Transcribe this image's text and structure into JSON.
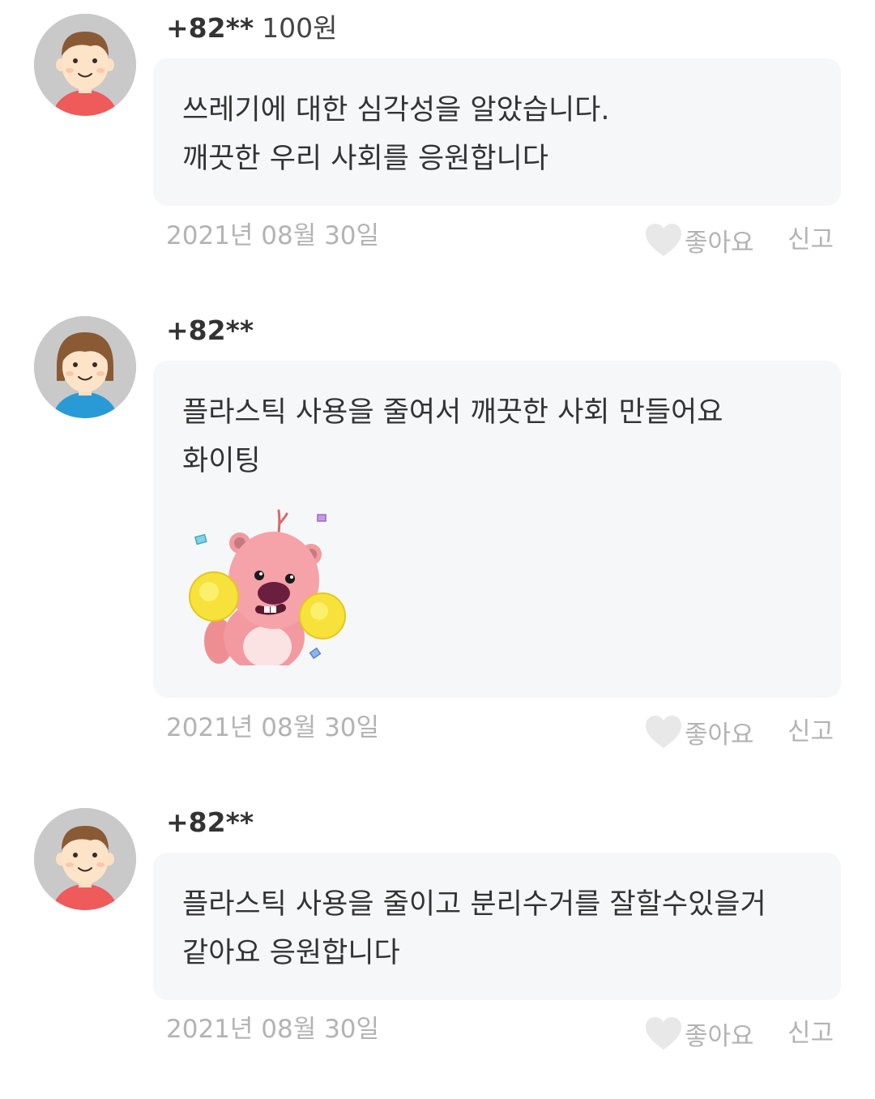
{
  "comments": [
    {
      "author": "+82**",
      "donation": "100원",
      "text": "쓰레기에 대한 심각성을 알았습니다.\n깨끗한 우리 사회를 응원합니다",
      "date": "2021년 08월 30일",
      "like_label": "좋아요",
      "report_label": "신고",
      "avatar": "boy-avatar",
      "shirt_color": "#ef5a5a"
    },
    {
      "author": "+82**",
      "donation": "",
      "text": "플라스틱 사용을 줄여서 깨끗한 사회 만들어요\n화이팅",
      "sticker": "pink-beaver-cheerleader-sticker",
      "date": "2021년 08월 30일",
      "like_label": "좋아요",
      "report_label": "신고",
      "avatar": "girl-avatar",
      "shirt_color": "#2a9ad6"
    },
    {
      "author": "+82**",
      "donation": "",
      "text": "플라스틱 사용을 줄이고 분리수거를 잘할수있을거\n같아요 응원합니다",
      "date": "2021년 08월 30일",
      "like_label": "좋아요",
      "report_label": "신고",
      "avatar": "boy-avatar",
      "shirt_color": "#ef5a5a"
    }
  ]
}
